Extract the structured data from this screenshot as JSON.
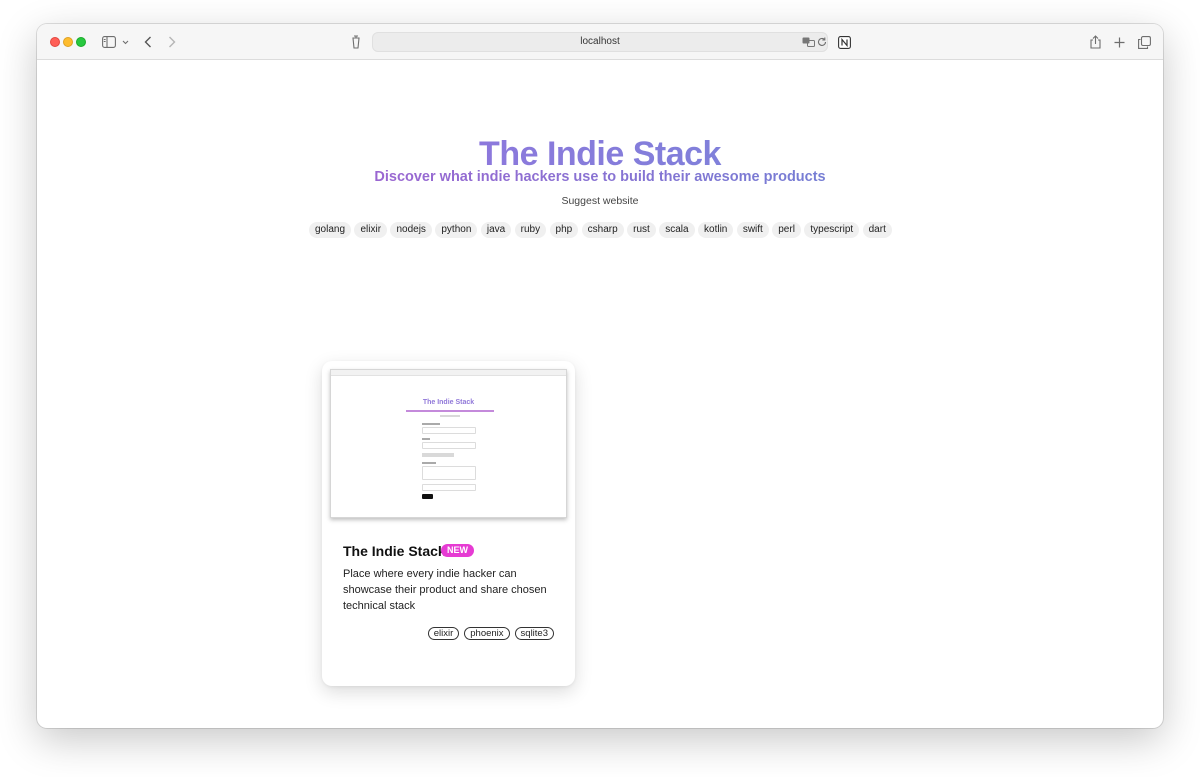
{
  "browser": {
    "address": "localhost",
    "icons": [
      "sidebar-icon",
      "chevron-down-icon",
      "back-icon",
      "forward-icon",
      "shield-icon",
      "translate-icon",
      "reload-icon",
      "notion-icon",
      "share-icon",
      "plus-icon",
      "tabs-icon"
    ]
  },
  "hero": {
    "title": "The Indie Stack",
    "subtitle": "Discover what indie hackers use to build their awesome products",
    "suggest": "Suggest website"
  },
  "tags": [
    "golang",
    "elixir",
    "nodejs",
    "python",
    "java",
    "ruby",
    "php",
    "csharp",
    "rust",
    "scala",
    "kotlin",
    "swift",
    "perl",
    "typescript",
    "dart"
  ],
  "card": {
    "title": "The Indie Stack",
    "badge": "NEW",
    "description": "Place where every indie hacker can showcase their product and share chosen technical stack",
    "tags": [
      "elixir",
      "phoenix",
      "sqlite3"
    ],
    "screenshot_title": "The Indie Stack"
  },
  "colors": {
    "title_gradient_start": "#a26ade",
    "title_gradient_end": "#6a8ed8",
    "badge": "#e63bd3"
  }
}
